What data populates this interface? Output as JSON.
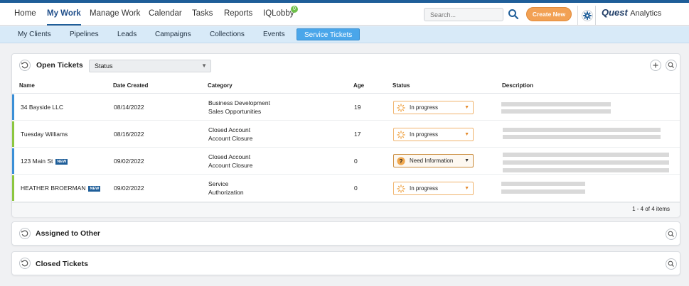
{
  "nav": {
    "items": [
      "Home",
      "My Work",
      "Manage Work",
      "Calendar",
      "Tasks",
      "Reports",
      "IQLobby"
    ],
    "iqlobby_badge": "0",
    "search_placeholder": "Search...",
    "create_label": "Create New",
    "logo_q": "Quest",
    "logo_rest": "Analytics"
  },
  "subnav": {
    "items": [
      "My Clients",
      "Pipelines",
      "Leads",
      "Campaigns",
      "Collections",
      "Events",
      "Service Tickets"
    ]
  },
  "open_tickets": {
    "title": "Open Tickets",
    "status_filter": "Status",
    "columns": [
      "Name",
      "Date Created",
      "Category",
      "Age",
      "Status",
      "Description"
    ],
    "rows": [
      {
        "name": "34 Bayside LLC",
        "new": "",
        "date": "08/14/2022",
        "category1": "Business Development",
        "category2": "Sales Opportunities",
        "age": "19",
        "status": "In progress",
        "accent": "#3b8fd6"
      },
      {
        "name": "Tuesday Williams",
        "new": "",
        "date": "08/16/2022",
        "category1": "Closed Account",
        "category2": "Account Closure",
        "age": "17",
        "status": "In progress",
        "accent": "#8cc63f"
      },
      {
        "name": "123 Main St",
        "new": "NEW",
        "date": "09/02/2022",
        "category1": "Closed Account",
        "category2": "Account Closure",
        "age": "0",
        "status": "Need Information",
        "accent": "#3b8fd6"
      },
      {
        "name": "HEATHER BROERMAN",
        "new": "NEW",
        "date": "09/02/2022",
        "category1": "Service",
        "category2": "Authorization",
        "age": "0",
        "status": "In progress",
        "accent": "#8cc63f"
      }
    ],
    "pagination": "1 - 4 of 4 items"
  },
  "assigned": {
    "title": "Assigned to Other"
  },
  "closed": {
    "title": "Closed Tickets"
  },
  "colors": {
    "brand": "#1f5e99",
    "accent_orange": "#f2a154",
    "subnav_active": "#4aa6ea"
  }
}
